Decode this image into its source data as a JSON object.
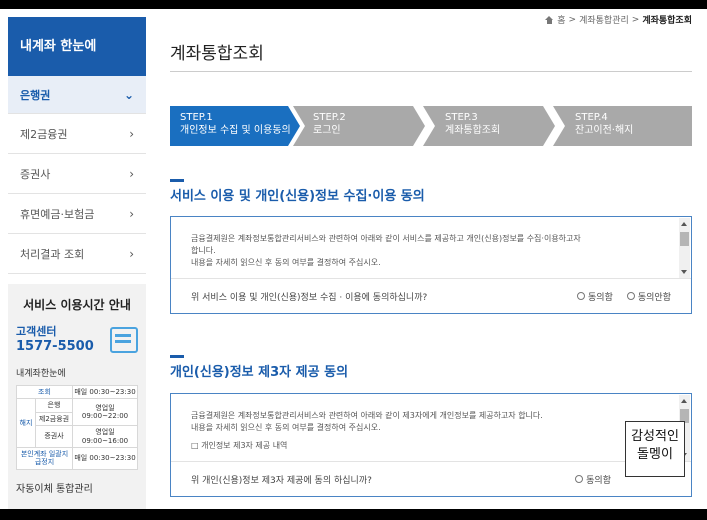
{
  "sidebar": {
    "heading": "내계좌 한눈에",
    "items": [
      {
        "label": "은행권",
        "active": true
      },
      {
        "label": "제2금융권",
        "active": false
      },
      {
        "label": "증권사",
        "active": false
      },
      {
        "label": "휴면예금·보험금",
        "active": false
      },
      {
        "label": "처리결과 조회",
        "active": false
      }
    ],
    "service": {
      "title": "서비스 이용시간 안내",
      "cc_label": "고객센터",
      "cc_phone": "1577-5500",
      "icon": "computer-icon",
      "subtitle": "내계좌한눈에",
      "rows": [
        {
          "cat": "조회",
          "sub": "",
          "time": "매일 00:30~23:30"
        },
        {
          "cat": "해지",
          "sub": "은행",
          "time": "영업일 09:00~22:00"
        },
        {
          "cat": "",
          "sub": "제2금융권",
          "time": ""
        },
        {
          "cat": "",
          "sub": "증권사",
          "time": "영업일 09:00~16:00"
        },
        {
          "cat": "본인계좌 일괄지급정지",
          "sub": "",
          "time": "매일 00:30~23:30"
        }
      ],
      "footer": "자동이체 통합관리"
    }
  },
  "breadcrumb": {
    "home": "홈",
    "level1": "계좌통합관리",
    "current": "계좌통합조회",
    "separator": ">"
  },
  "page_title": "계좌통합조회",
  "steps": [
    {
      "num": "STEP.1",
      "label": "개인정보 수집 및 이용동의",
      "active": true
    },
    {
      "num": "STEP.2",
      "label": "로그인",
      "active": false
    },
    {
      "num": "STEP.3",
      "label": "계좌통합조회",
      "active": false
    },
    {
      "num": "STEP.4",
      "label": "잔고이전·해지",
      "active": false
    }
  ],
  "section1": {
    "title": "서비스 이용 및 개인(신용)정보 수집·이용 동의",
    "text1": "금융결제원은 계좌정보통합관리서비스와 관련하여 아래와 같이 서비스를 제공하고 개인(신용)정보를 수집·이용하고자",
    "text2": "합니다.",
    "text3": "내용을 자세히 읽으신 후 동의 여부를 결정하여 주십시오.",
    "question": "위 서비스 이용 및 개인(신용)정보 수집 · 이용에 동의하십니까?",
    "agree": "동의함",
    "disagree": "동의안함"
  },
  "section2": {
    "title": "개인(신용)정보 제3자 제공 동의",
    "text1": "금융결제원은 계좌정보통합관리서비스와 관련하여 아래와 같이 제3자에게 개인정보를 제공하고자 합니다.",
    "text2": "내용을 자세히 읽으신 후 동의 여부를 결정하여 주십시오.",
    "text3": "□ 개인정보 제3자 제공 내역",
    "question": "위 개인(신용)정보 제3자 제공에 동의 하십니까?",
    "agree": "동의함"
  },
  "overlay": {
    "line1": "감성적인",
    "line2": "돌멩이"
  },
  "colors": {
    "primary": "#1a5cab",
    "step_active": "#1a6fc0",
    "step_inactive": "#a9a9a9"
  }
}
